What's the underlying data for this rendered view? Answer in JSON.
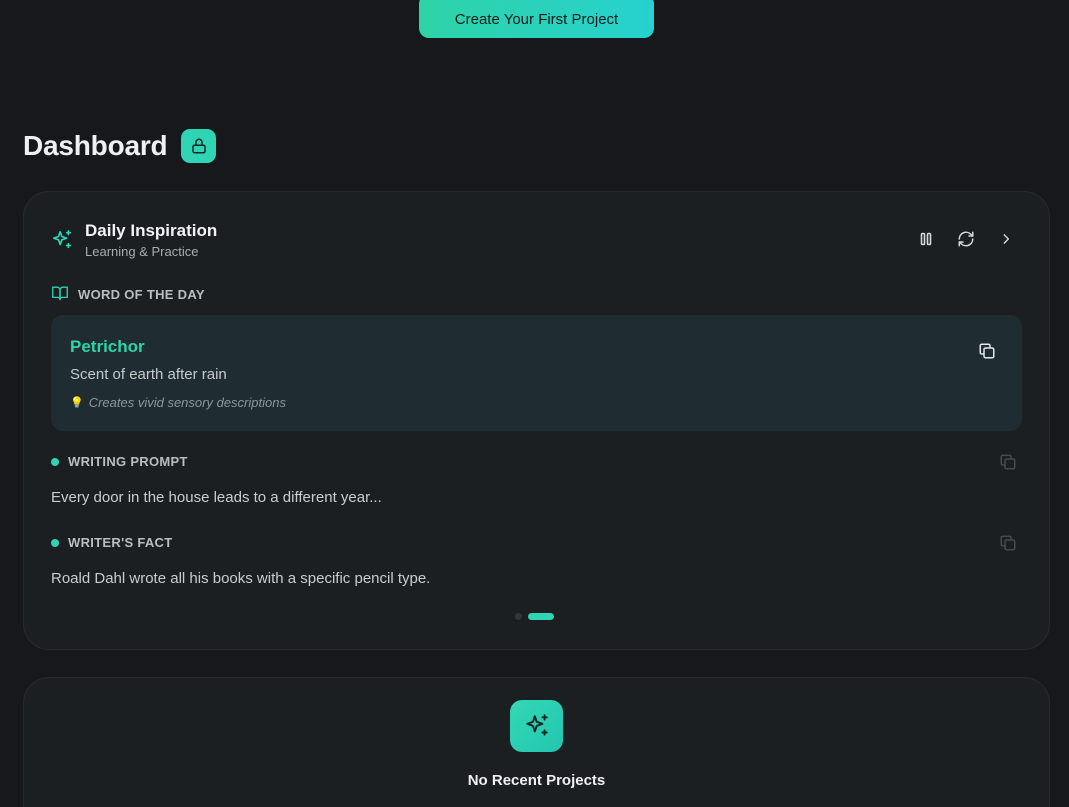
{
  "cta": {
    "label": "Create Your First Project"
  },
  "dashboard": {
    "title": "Dashboard"
  },
  "inspiration": {
    "title": "Daily Inspiration",
    "subtitle": "Learning & Practice",
    "word_section_label": "WORD OF THE DAY",
    "word": {
      "term": "Petrichor",
      "definition": "Scent of earth after rain",
      "tip_icon": "💡",
      "tip": "Creates vivid sensory descriptions"
    },
    "prompt_section_label": "WRITING PROMPT",
    "prompt_text": "Every door in the house leads to a different year...",
    "fact_section_label": "WRITER'S FACT",
    "fact_text": "Roald Dahl wrote all his books with a specific pencil type.",
    "pager": {
      "total": 2,
      "active": 2
    }
  },
  "recent": {
    "empty_title": "No Recent Projects"
  },
  "colors": {
    "accent": "#2fd4b4",
    "accent_text": "#2fd4a6",
    "background": "#16181b",
    "card": "#1c1f22"
  }
}
